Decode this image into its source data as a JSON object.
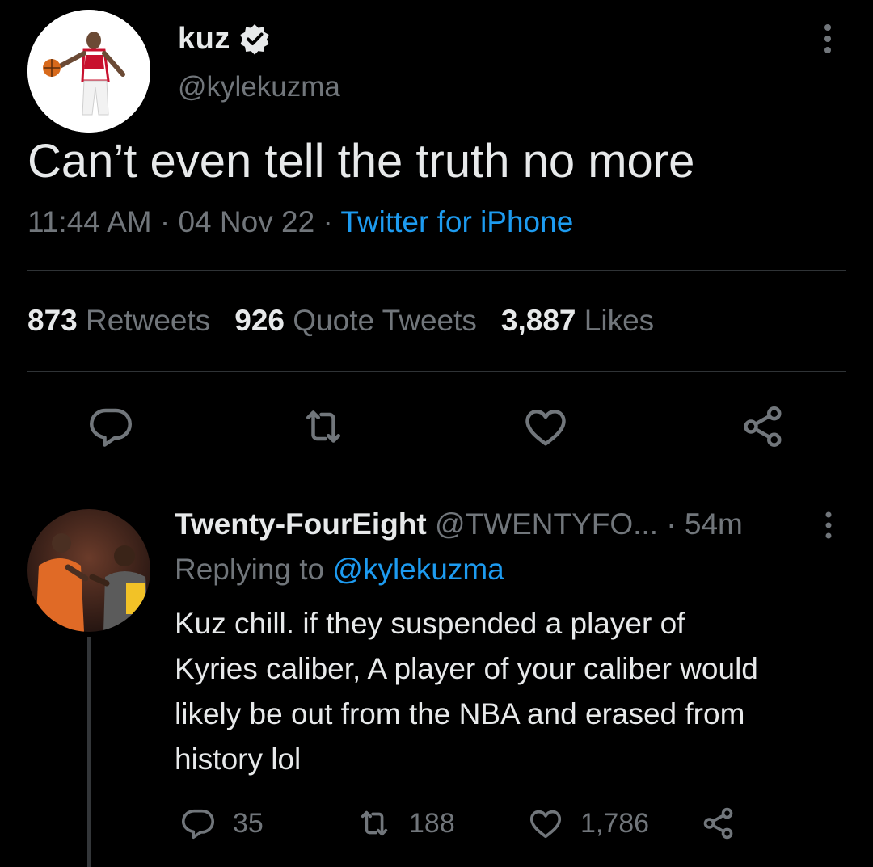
{
  "main_tweet": {
    "display_name": "kuz",
    "handle": "@kylekuzma",
    "text": "Can’t even tell the truth no more",
    "time": "11:44 AM",
    "date": "04 Nov 22",
    "source": "Twitter for iPhone",
    "stats": {
      "retweets_count": "873",
      "retweets_label": "Retweets",
      "quotes_count": "926",
      "quotes_label": "Quote Tweets",
      "likes_count": "3,887",
      "likes_label": "Likes"
    }
  },
  "reply": {
    "display_name": "Twenty-FourEight",
    "handle": "@TWENTYFO...",
    "age": "54m",
    "replying_label": "Replying to",
    "replying_to": "@kylekuzma",
    "text_lines": [
      "Kuz chill. if they suspended a player of",
      "Kyries caliber, A player of your caliber would",
      "likely be out from the NBA and erased from",
      "history lol"
    ],
    "counts": {
      "replies": "35",
      "retweets": "188",
      "likes": "1,786"
    }
  },
  "colors": {
    "background": "#000000",
    "primary_text": "#e7e9ea",
    "secondary_text": "#71767b",
    "accent": "#1d9bf0",
    "divider": "#2f3336"
  },
  "icons": {
    "verified": "verified-badge-icon",
    "more": "more-vertical-icon",
    "reply": "reply-bubble-icon",
    "retweet": "retweet-icon",
    "like": "heart-icon",
    "share": "share-icon"
  }
}
